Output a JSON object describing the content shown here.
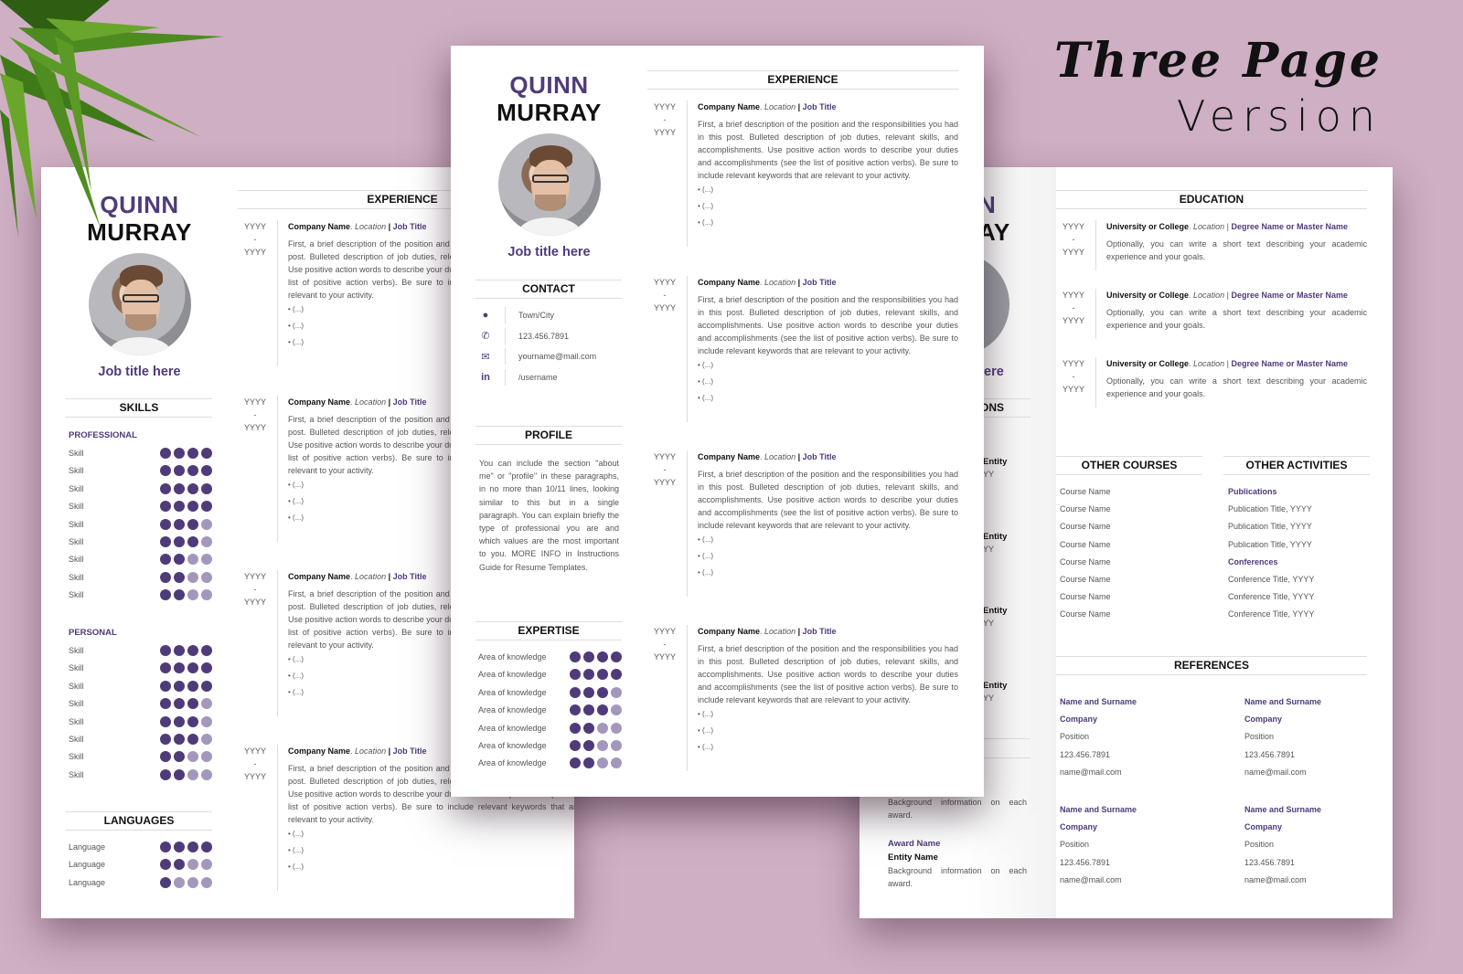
{
  "banner": {
    "line1": "Three Page",
    "line2": "Version"
  },
  "colors": {
    "accent": "#4f3b7a",
    "accent_light": "#a497bd",
    "background": "#cfafc3"
  },
  "profile": {
    "first_name": "QUINN",
    "last_name": "MURRAY",
    "job_title": "Job title here"
  },
  "experience": {
    "heading": "EXPERIENCE",
    "entries": [
      {
        "start": "YYYY",
        "sep": "-",
        "end": "YYYY",
        "company": "Company Name",
        "location": "Location",
        "pipe": "|",
        "job_title": "Job Title",
        "description": "First, a brief description of the position and the responsibilities you had in this post. Bulleted description of job duties, relevant skills, and accomplishments. Use positive action words to describe your duties and accomplishments (see the list of positive action verbs). Be sure to include relevant keywords that are relevant to your activity.",
        "bullets": [
          "• (...)",
          "• (...)",
          "• (...)"
        ]
      }
    ]
  },
  "contact": {
    "heading": "CONTACT",
    "items": [
      {
        "icon": "location-pin-icon",
        "glyph": "●",
        "value": "Town/City"
      },
      {
        "icon": "phone-icon",
        "glyph": "✆",
        "value": "123.456.7891"
      },
      {
        "icon": "mail-icon",
        "glyph": "✉",
        "value": "yourname@mail.com"
      },
      {
        "icon": "linkedin-icon",
        "glyph": "in",
        "value": "/username"
      }
    ]
  },
  "profile_section": {
    "heading": "PROFILE",
    "text": "You can include the section \"about me\" or \"profile\" in these paragraphs, in no more than 10/11 lines, looking similar to this but in a single paragraph. You can explain briefly the type of professional you are and which values are the most important to you. MORE INFO in Instructions Guide for Resume Templates."
  },
  "expertise": {
    "heading": "EXPERTISE",
    "items": [
      {
        "label": "Area of knowledge",
        "level": 4,
        "max": 4
      },
      {
        "label": "Area of knowledge",
        "level": 4,
        "max": 4
      },
      {
        "label": "Area of knowledge",
        "level": 3,
        "max": 4
      },
      {
        "label": "Area of knowledge",
        "level": 3,
        "max": 4
      },
      {
        "label": "Area of knowledge",
        "level": 2,
        "max": 4
      },
      {
        "label": "Area of knowledge",
        "level": 2,
        "max": 4
      },
      {
        "label": "Area of knowledge",
        "level": 2,
        "max": 4
      }
    ]
  },
  "skills": {
    "heading": "SKILLS",
    "professional_label": "PROFESSIONAL",
    "professional": [
      {
        "label": "Skill",
        "level": 4
      },
      {
        "label": "Skill",
        "level": 4
      },
      {
        "label": "Skill",
        "level": 4
      },
      {
        "label": "Skill",
        "level": 4
      },
      {
        "label": "Skill",
        "level": 3
      },
      {
        "label": "Skill",
        "level": 3
      },
      {
        "label": "Skill",
        "level": 2
      },
      {
        "label": "Skill",
        "level": 2
      },
      {
        "label": "Skill",
        "level": 2
      }
    ],
    "personal_label": "PERSONAL",
    "personal": [
      {
        "label": "Skill",
        "level": 4
      },
      {
        "label": "Skill",
        "level": 4
      },
      {
        "label": "Skill",
        "level": 4
      },
      {
        "label": "Skill",
        "level": 3
      },
      {
        "label": "Skill",
        "level": 3
      },
      {
        "label": "Skill",
        "level": 3
      },
      {
        "label": "Skill",
        "level": 2
      },
      {
        "label": "Skill",
        "level": 2
      }
    ]
  },
  "languages": {
    "heading": "LANGUAGES",
    "items": [
      {
        "label": "Language",
        "level": 4
      },
      {
        "label": "Language",
        "level": 2
      },
      {
        "label": "Language",
        "level": 1
      }
    ]
  },
  "education": {
    "heading": "EDUCATION",
    "entries": [
      {
        "start": "YYYY",
        "sep": "-",
        "end": "YYYY",
        "school": "University or College",
        "location": "Location",
        "pipe": "|",
        "degree": "Degree Name or Master Name",
        "text": "Optionally, you can write a short text describing your academic experience and your goals."
      },
      {
        "start": "YYYY",
        "sep": "-",
        "end": "YYYY",
        "school": "University or College",
        "location": "Location",
        "pipe": "|",
        "degree": "Degree Name or Master Name",
        "text": "Optionally, you can write a short text describing your academic experience and your goals."
      },
      {
        "start": "YYYY",
        "sep": "-",
        "end": "YYYY",
        "school": "University or College",
        "location": "Location",
        "pipe": "|",
        "degree": "Degree Name or Master Name",
        "text": "Optionally, you can write a short text describing your academic experience and your goals."
      }
    ]
  },
  "other_courses": {
    "heading": "OTHER COURSES",
    "items": [
      "Course Name",
      "Course Name",
      "Course Name",
      "Course Name",
      "Course Name",
      "Course Name",
      "Course Name",
      "Course Name"
    ]
  },
  "other_activities": {
    "heading": "OTHER ACTIVITIES",
    "items": [
      {
        "text": "Publications",
        "type": "heading"
      },
      {
        "text": "Publication Title, YYYY",
        "type": "item"
      },
      {
        "text": "Publication Title, YYYY",
        "type": "item"
      },
      {
        "text": "Publication Title, YYYY",
        "type": "item"
      },
      {
        "text": "Conferences",
        "type": "heading"
      },
      {
        "text": "Conference Title, YYYY",
        "type": "item"
      },
      {
        "text": "Conference Title, YYYY",
        "type": "item"
      },
      {
        "text": "Conference Title, YYYY",
        "type": "item"
      }
    ]
  },
  "references": {
    "heading": "REFERENCES",
    "entries": [
      {
        "name": "Name and Surname",
        "company": "Company",
        "position": "Position",
        "phone": "123.456.7891",
        "email": "name@mail.com"
      },
      {
        "name": "Name and Surname",
        "company": "Company",
        "position": "Position",
        "phone": "123.456.7891",
        "email": "name@mail.com"
      },
      {
        "name": "Name and Surname",
        "company": "Company",
        "position": "Position",
        "phone": "123.456.7891",
        "email": "name@mail.com"
      },
      {
        "name": "Name and Surname",
        "company": "Company",
        "position": "Position",
        "phone": "123.456.7891",
        "email": "name@mail.com"
      }
    ]
  },
  "right_page_partial": {
    "name_first_fragment": "N",
    "name_last_fragment": "AY",
    "job_title_fragment": "ere",
    "section_fragment": "ONS",
    "entity_fragments": [
      {
        "entity": "Entity",
        "year": "YY"
      },
      {
        "entity": "Entity",
        "year": "YY"
      },
      {
        "entity": "Entity",
        "year": "YY"
      },
      {
        "entity": "Entity",
        "year": "YY"
      }
    ],
    "awards": [
      {
        "text": "Background information on each award."
      },
      {
        "award_name": "Award Name",
        "entity_name": "Entity Name",
        "text": "Background information on each award."
      }
    ]
  }
}
